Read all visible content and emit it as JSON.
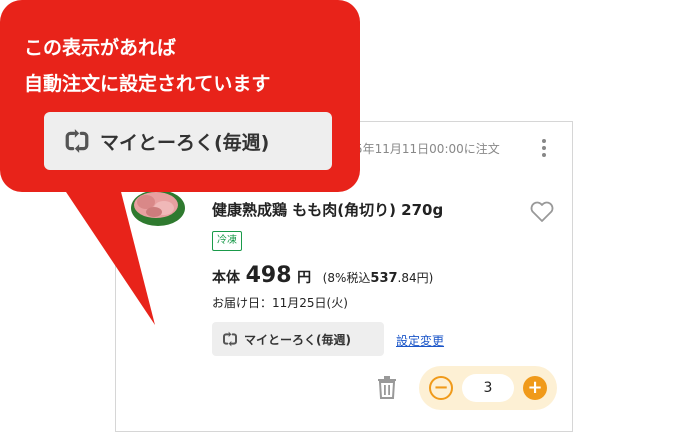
{
  "callout": {
    "line1": "この表示があれば",
    "line2": "自動注文に設定されています",
    "chip_label": "マイとーろく(毎週)",
    "color": "#e8231a"
  },
  "product": {
    "order_date": "5年11月11日00:00に注文",
    "name": "健康熟成鶏 もも肉(角切り) 270g",
    "badge": "冷凍",
    "price_label": "本体",
    "price": "498",
    "price_unit": "円",
    "tax_prefix": "(8%税込",
    "tax_price": "537",
    "tax_suffix": ".84円)",
    "delivery": "お届け日：11月25日(火)",
    "subscription_label": "マイとーろく(毎週)",
    "change_link": "設定変更",
    "quantity": "3",
    "accent_color": "#f09a1a",
    "icons": [
      "kebab-menu-icon",
      "heart-icon",
      "refresh-icon",
      "trash-icon",
      "minus-icon",
      "plus-icon"
    ]
  }
}
